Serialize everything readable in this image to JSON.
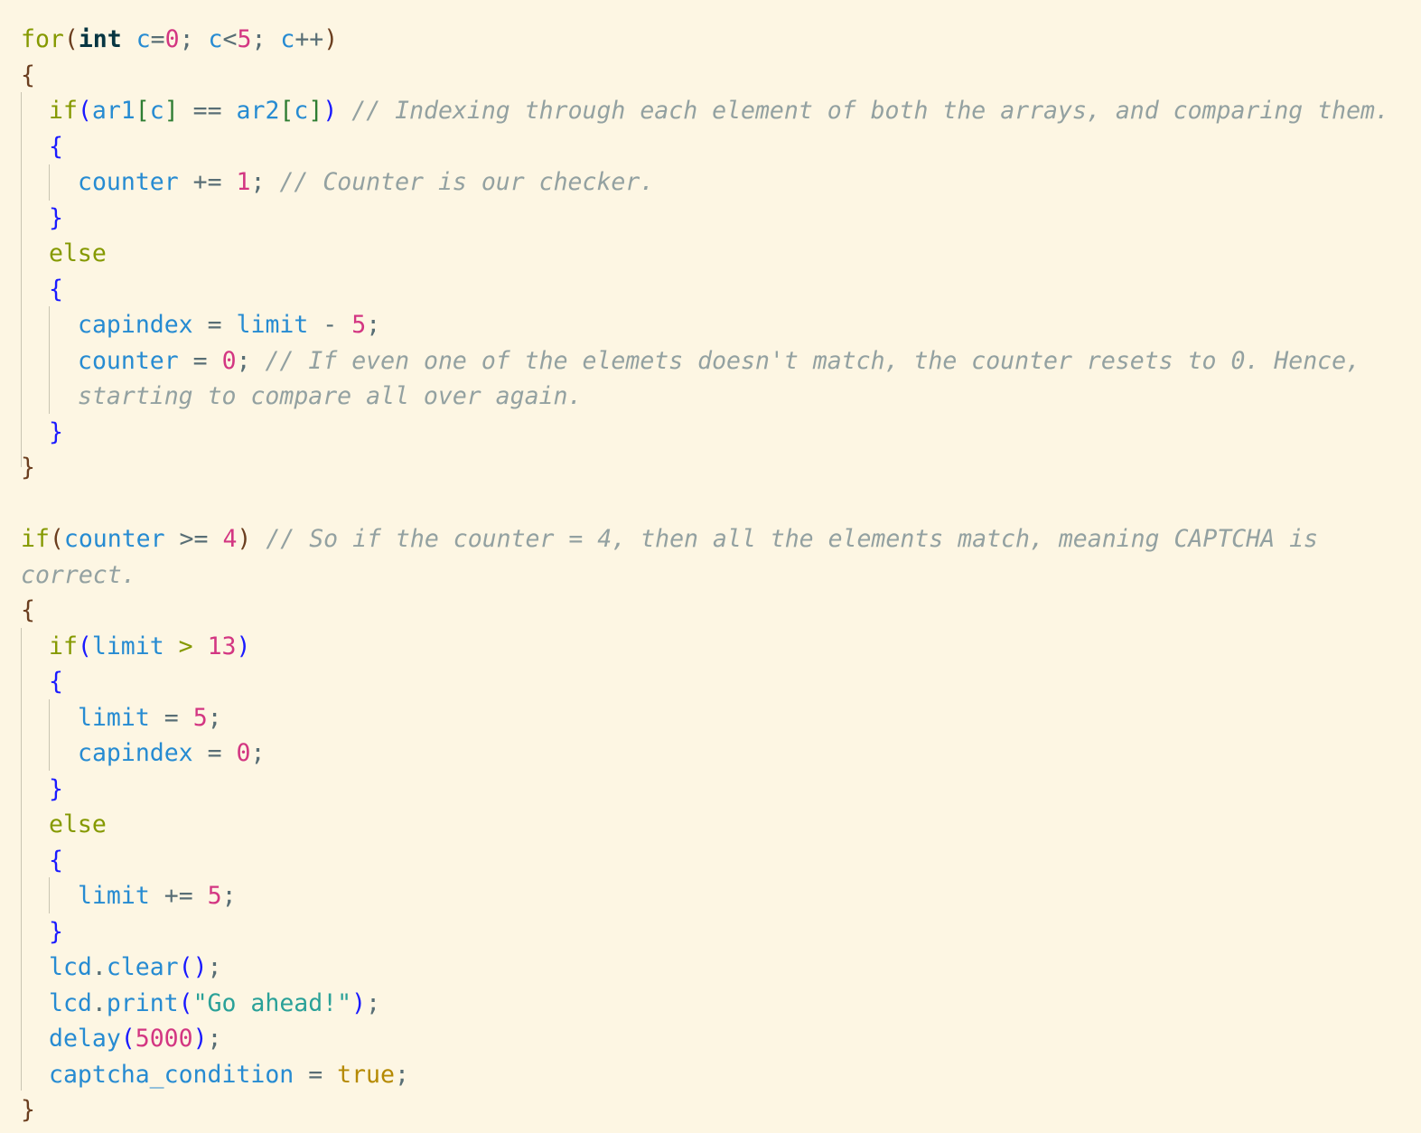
{
  "editor": {
    "language": "C++ (Arduino)",
    "theme": {
      "background": "#fdf6e3",
      "keyword": "#859900",
      "identifier": "#268bd2",
      "number": "#d33682",
      "string": "#2aa198",
      "comment": "#93a1a1",
      "brace_level0": "#6b3e1f",
      "brace_level1": "#1a1aff"
    },
    "comments": {
      "indexing": "// Indexing through each element of both the arrays, and comparing them.",
      "checker": "// Counter is our checker.",
      "reset_line1": "// If even one of the elemets doesn't match, the counter resets to 0. Hence,",
      "reset_line2": "starting to compare all over again.",
      "captcha_line1": "// So if the counter = 4, then all the elements match, meaning CAPTCHA is",
      "captcha_line2": "correct."
    },
    "strings": {
      "go_ahead": "\"Go ahead!\""
    },
    "numbers": {
      "zero": "0",
      "five": "5",
      "one": "1",
      "four": "4",
      "thirteen": "13",
      "delay_ms": "5000"
    }
  }
}
